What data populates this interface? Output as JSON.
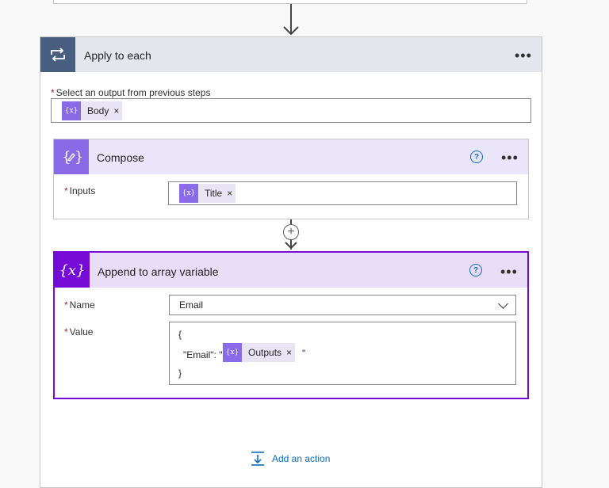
{
  "apply_to_each": {
    "title": "Apply to each",
    "more_label": "•••",
    "select_label": "Select an output from previous steps",
    "required_mark": "*",
    "token": {
      "label": "Body",
      "icon": "expression-icon",
      "remove": "×"
    }
  },
  "compose": {
    "title": "Compose",
    "more_label": "•••",
    "help_label": "?",
    "inputs_label": "Inputs",
    "required_mark": "*",
    "token": {
      "label": "Title",
      "icon": "expression-icon",
      "remove": "×"
    }
  },
  "connector": {
    "plus_label": "+"
  },
  "append_to_array": {
    "title": "Append to array variable",
    "more_label": "•••",
    "help_label": "?",
    "name_label": "Name",
    "name_value": "Email",
    "value_label": "Value",
    "required_mark": "*",
    "value_lines": {
      "open": "{",
      "key_prefix": "\"Email\": \"",
      "key_suffix": "\"",
      "close": "}"
    },
    "token": {
      "label": "Outputs",
      "icon": "expression-icon",
      "remove": "×"
    }
  },
  "add_action": {
    "label": "Add an action",
    "icon": "add-action-icon"
  },
  "colors": {
    "apply_header": "#e3e6ec",
    "apply_icon": "#485f80",
    "compose_header": "#ebe5fb",
    "compose_icon": "#8a6ae6",
    "append_header": "#e9dcf7",
    "append_icon": "#770bd6",
    "accent_blue": "#0f6cbd",
    "required_red": "#a4262c"
  }
}
